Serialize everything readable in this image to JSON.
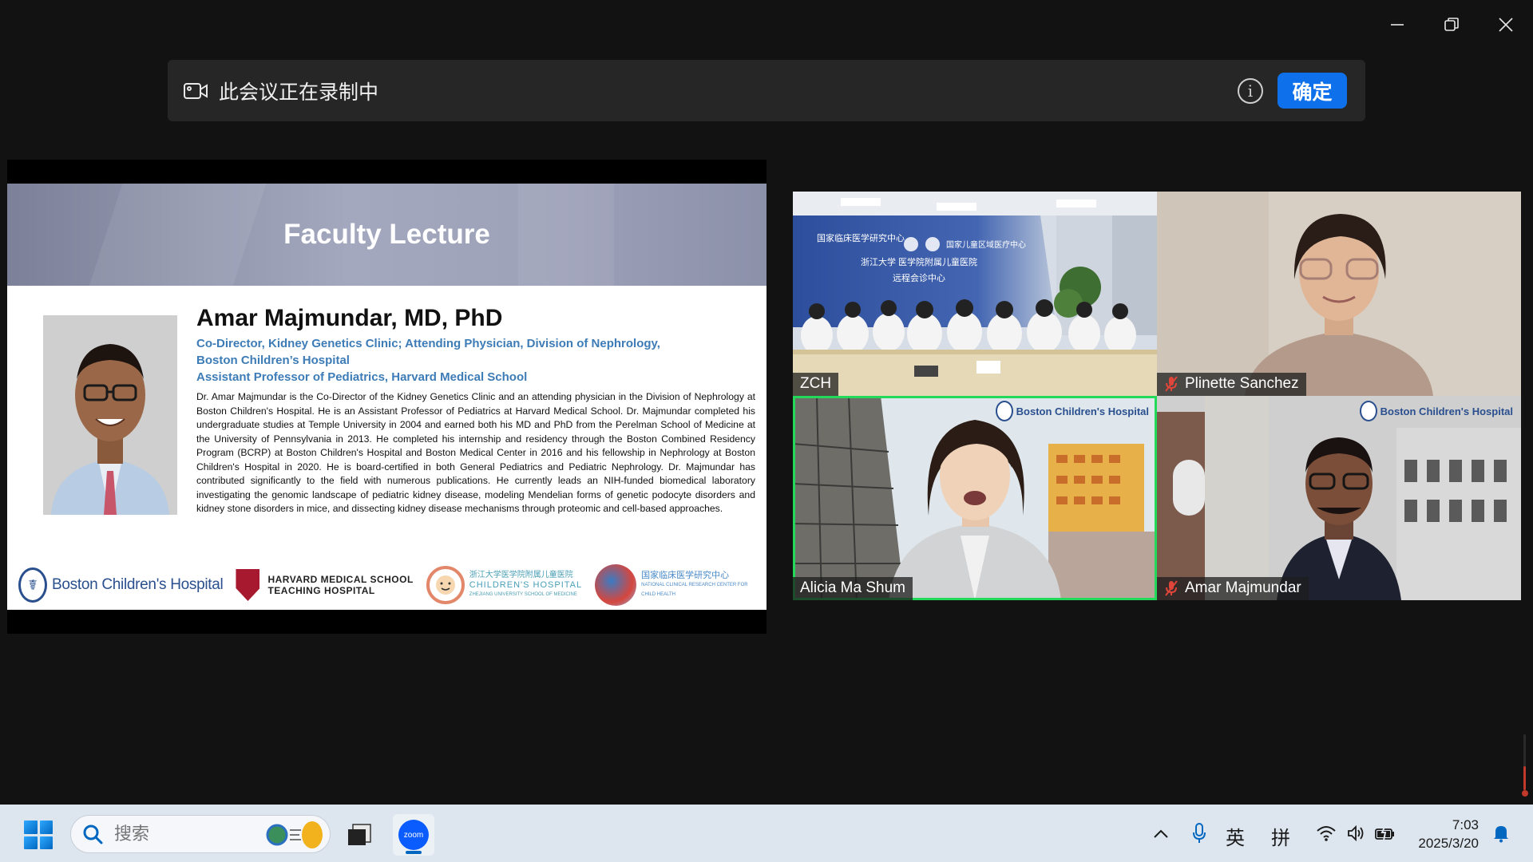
{
  "window": {
    "minimize_label": "minimize",
    "restore_label": "restore",
    "close_label": "close"
  },
  "recording_banner": {
    "text": "此会议正在录制中",
    "confirm_label": "确定"
  },
  "slide": {
    "title": "Faculty Lecture",
    "speaker_name": "Amar Majmundar, MD, PhD",
    "role_line_1": "Co-Director, Kidney Genetics Clinic; Attending Physician, Division of Nephrology,",
    "role_line_2": "Boston Children’s Hospital",
    "role_line_3": "Assistant Professor of Pediatrics, Harvard Medical School",
    "bio": "Dr. Amar Majmundar is the Co-Director of the Kidney Genetics Clinic and an attending physician in the Division of Nephrology at Boston Children's Hospital. He is an Assistant Professor of Pediatrics at Harvard Medical School. Dr. Majmundar completed his undergraduate studies at Temple University in 2004 and earned both his MD and PhD from the Perelman School of Medicine at the University of Pennsylvania in 2013. He completed his internship and residency through the Boston Combined Residency Program (BCRP) at Boston Children's Hospital and Boston Medical Center in 2016 and his fellowship in Nephrology at Boston Children's Hospital in 2020. He is board-certified in both General Pediatrics and Pediatric Nephrology. Dr. Majmundar has contributed significantly to the field with numerous publications. He currently leads an NIH-funded biomedical laboratory investigating the genomic landscape of pediatric kidney disease, modeling Mendelian forms of genetic podocyte disorders and kidney stone disorders in mice, and dissecting kidney disease mechanisms through proteomic and cell-based approaches.",
    "logos": {
      "bch": "Boston Children's Hospital",
      "hms_line_1": "HARVARD MEDICAL SCHOOL",
      "hms_line_2": "TEACHING HOSPITAL",
      "zch_line_1": "浙江大学医学院附属儿童医院",
      "zch_line_2": "CHILDREN'S HOSPITAL",
      "zch_line_3": "ZHEJIANG UNIVERSITY SCHOOL OF MEDICINE",
      "ncrc_line_1": "国家临床医学研究中心",
      "ncrc_line_2": "NATIONAL CLINICAL RESEARCH CENTER FOR",
      "ncrc_line_3": "CHILD HEALTH"
    }
  },
  "participants": [
    {
      "name": "ZCH",
      "muted": false,
      "active": false
    },
    {
      "name": "Plinette Sanchez",
      "muted": true,
      "active": false
    },
    {
      "name": "Alicia Ma Shum",
      "muted": false,
      "active": true
    },
    {
      "name": "Amar Majmundar",
      "muted": true,
      "active": false
    }
  ],
  "tile_badges": {
    "bch": "Boston Children's Hospital"
  },
  "zch_room": {
    "sign_line_1": "国家临床医学研究中心",
    "sign_line_2": "国家儿童区域医疗中心",
    "sign_line_3": "浙江大学 医学院附属儿童医院",
    "sign_line_4": "远程会诊中心"
  },
  "taskbar": {
    "search_placeholder": "搜索",
    "zoom_label": "zoom",
    "ime_lang": "英",
    "ime_mode": "拼",
    "time": "7:03",
    "date": "2025/3/20"
  },
  "colors": {
    "accent": "#0e71eb",
    "active_speaker": "#23d959",
    "slide_role": "#3d7cb6",
    "mute_red": "#e0453a"
  }
}
